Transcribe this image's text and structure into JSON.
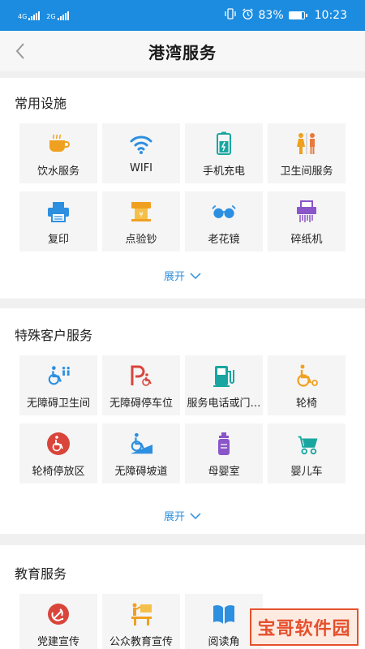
{
  "status_bar": {
    "sim1": "4G",
    "sim2": "2G",
    "battery": "83%",
    "battery_level": 0.83,
    "time": "10:23"
  },
  "header": {
    "title": "港湾服务"
  },
  "sections": [
    {
      "title": "常用设施",
      "expand_label": "展开",
      "items": [
        {
          "label": "饮水服务",
          "icon": "cup-icon"
        },
        {
          "label": "WIFI",
          "icon": "wifi-icon"
        },
        {
          "label": "手机充电",
          "icon": "charging-phone-icon"
        },
        {
          "label": "卫生间服务",
          "icon": "restroom-icon"
        },
        {
          "label": "复印",
          "icon": "printer-icon"
        },
        {
          "label": "点验钞",
          "icon": "cash-counter-icon"
        },
        {
          "label": "老花镜",
          "icon": "glasses-icon"
        },
        {
          "label": "碎纸机",
          "icon": "shredder-icon"
        }
      ]
    },
    {
      "title": "特殊客户服务",
      "expand_label": "展开",
      "items": [
        {
          "label": "无障碍卫生间",
          "icon": "accessible-restroom-icon"
        },
        {
          "label": "无障碍停车位",
          "icon": "accessible-parking-icon"
        },
        {
          "label": "服务电话或门…",
          "icon": "service-phone-icon"
        },
        {
          "label": "轮椅",
          "icon": "wheelchair-icon"
        },
        {
          "label": "轮椅停放区",
          "icon": "wheelchair-parking-icon"
        },
        {
          "label": "无障碍坡道",
          "icon": "ramp-icon"
        },
        {
          "label": "母婴室",
          "icon": "baby-bottle-icon"
        },
        {
          "label": "婴儿车",
          "icon": "stroller-icon"
        }
      ]
    },
    {
      "title": "教育服务",
      "items": [
        {
          "label": "党建宣传",
          "icon": "party-emblem-icon"
        },
        {
          "label": "公众教育宣传",
          "icon": "presentation-icon"
        },
        {
          "label": "阅读角",
          "icon": "book-icon"
        }
      ]
    }
  ],
  "watermark": "宝哥软件园",
  "colors": {
    "status_bar": "#1c8ce0",
    "accent_blue": "#2d8fe0",
    "orange": "#f0a020",
    "red": "#d9453b",
    "purple": "#8a55c8",
    "teal": "#1aa6a0"
  }
}
